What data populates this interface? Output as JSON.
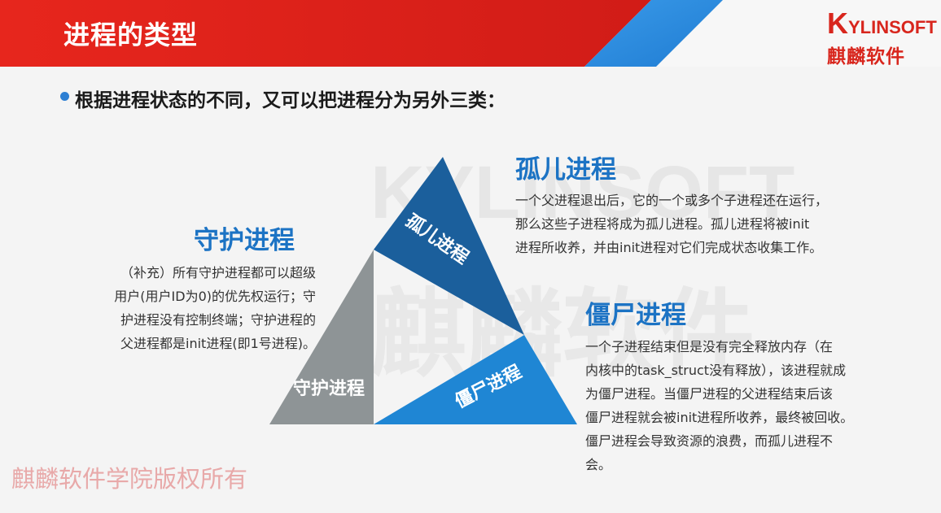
{
  "header": {
    "title": "进程的类型",
    "logo_en": "YLINSOFT",
    "logo_en_initial": "K",
    "logo_cn": "麒麟软件"
  },
  "intro": {
    "text": "根据进程状态的不同，又可以把进程分为另外三类："
  },
  "daemon": {
    "title": "守护进程",
    "lines": [
      "（补充）所有守护进程都可以超级",
      "用户(用户ID为0)的优先权运行；守",
      "护进程没有控制终端；守护进程的",
      "父进程都是init进程(即1号进程)。"
    ],
    "tri_label": "守护进程"
  },
  "orphan": {
    "title": "孤儿进程",
    "lines": [
      "一个父进程退出后，它的一个或多个子进程还在运行，",
      "那么这些子进程将成为孤儿进程。孤儿进程将被init",
      "进程所收养，并由init进程对它们完成状态收集工作。"
    ],
    "tri_label": "孤儿进程"
  },
  "zombie": {
    "title": "僵尸进程",
    "lines": [
      "一个子进程结束但是没有完全释放内存（在",
      "内核中的task_struct没有释放），该进程就成",
      "为僵尸进程。当僵尸进程的父进程结束后该",
      "僵尸进程就会被init进程所收养，最终被回收。",
      "僵尸进程会导致资源的浪费，而孤儿进程不",
      "会。"
    ],
    "tri_label": "僵尸进程"
  },
  "watermark": {
    "text_en": "KYLINSOFT",
    "text_cn": "麒麟软件"
  },
  "footer": {
    "copyright": "麒麟软件学院版权所有"
  },
  "colors": {
    "header_red": "#e3221b",
    "header_blue": "#2f8fe0",
    "orphan_blue": "#1b5f9c",
    "zombie_blue": "#1f86d4",
    "daemon_gray": "#8e9496",
    "title_blue": "#1c73c4"
  }
}
